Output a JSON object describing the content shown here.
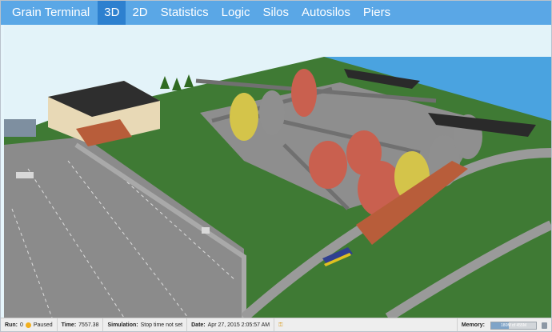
{
  "app": {
    "title": "Grain Terminal"
  },
  "nav": {
    "tabs": [
      {
        "label": "3D",
        "active": true
      },
      {
        "label": "2D"
      },
      {
        "label": "Statistics"
      },
      {
        "label": "Logic"
      },
      {
        "label": "Silos"
      },
      {
        "label": "Autosilos"
      },
      {
        "label": "Piers"
      }
    ]
  },
  "status": {
    "run_label": "Run:",
    "run_value": "0",
    "run_state": "Paused",
    "time_label": "Time:",
    "time_value": "7557.38",
    "simulation_label": "Simulation:",
    "simulation_value": "Stop time not set",
    "date_label": "Date:",
    "date_value": "Apr 27, 2015 2:05:57 AM",
    "memory_label": "Memory:",
    "memory_text": "180M of 455M",
    "memory_fraction": 0.4
  },
  "colors": {
    "nav_bar": "#5aa7e6",
    "nav_active": "#2d80cf",
    "grass": "#3f7a34",
    "water": "#4aa3e0",
    "asphalt": "#8b8b8b",
    "silo_red": "#c9604f",
    "silo_yellow": "#d4c44a",
    "silo_gray": "#8f8f8f"
  }
}
